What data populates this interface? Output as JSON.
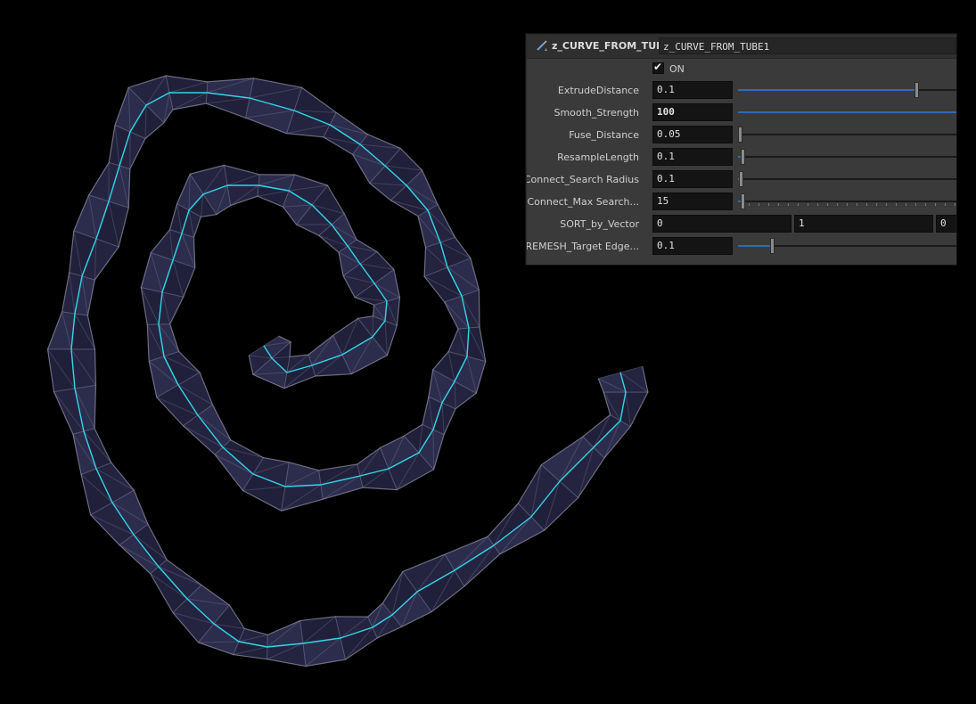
{
  "node": {
    "type_label": "z_CURVE_FROM_TUBE",
    "name": "z_CURVE_FROM_TUBE1",
    "icon": "wrench-icon"
  },
  "params": {
    "on": {
      "label": "ON",
      "checked": true
    },
    "extrude_distance": {
      "label": "ExtrudeDistance",
      "value": "0.1",
      "slider_fraction": 0.8
    },
    "smooth_strength": {
      "label": "Smooth_Strength",
      "value": "100",
      "slider_fraction": 1.0
    },
    "fuse_distance": {
      "label": "Fuse_Distance",
      "value": "0.05",
      "slider_fraction": 0.0
    },
    "resample_length": {
      "label": "ResampleLength",
      "value": "0.1",
      "slider_fraction": 0.02
    },
    "connect_search_radius": {
      "label": "Connect_Search Radius",
      "value": "0.1",
      "slider_fraction": 0.01
    },
    "connect_max_search": {
      "label": "Connect_Max Search...",
      "value": "15",
      "slider_fraction": 0.02
    },
    "sort_by_vector": {
      "label": "SORT_by_Vector",
      "values": [
        "0",
        "1",
        "0"
      ]
    },
    "remesh_target_edge": {
      "label": "REMESH_Target Edge...",
      "value": "0.1",
      "slider_fraction": 0.15
    }
  },
  "colors": {
    "curve": "#2fd6e6",
    "tube_fill": "#2a2a4a",
    "tube_edge": "#8a8aa6",
    "slider_fill": "#2f6ab8"
  }
}
